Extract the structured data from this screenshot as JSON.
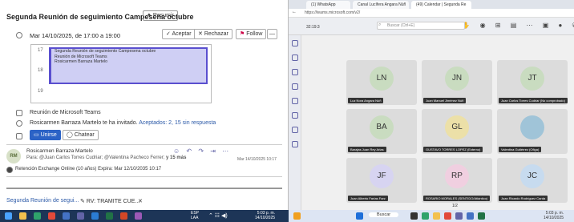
{
  "outlook": {
    "title": "Segunda Reunión de seguimiento Campesena octubre",
    "resume_label": "Resumir",
    "datetime": "Mar 14/10/2025, de 17:00 a 19:00",
    "accept_label": "Aceptar",
    "reject_label": "Rechazar",
    "follow_label": "Follow",
    "hours": [
      "17",
      "18",
      "19"
    ],
    "event_lines": [
      "Segunda Reunión de seguimiento Campesena octubre",
      "Reunión de Microsoft Teams",
      "Rosicarmen Barraza Martelo"
    ],
    "teams_meeting": "Reunión de Microsoft Teams",
    "invited_text": "Rosicarmen Barraza Martelo te ha invitado.",
    "accepted_text": "Aceptados: 2, 15 sin respuesta",
    "join_label": "Unirse",
    "chat_label": "Chatear",
    "avatar_initials": "RM",
    "sender": "Rosicarmen Barraza Martelo",
    "to_line": "Para: @Juan Carlos Torres Cudriar; @Valentina Pacheco Ferrer; ",
    "more": "y 15 más",
    "received": "Mar 14/10/2025 10:17",
    "retention": "Retención Exchange Online (10 años) Expira: Mar 12/10/2035 10:17",
    "bottom_tab1": "Segunda Reunión de segui...",
    "bottom_tab2": "RV: TRAMITE CUE...",
    "clock_time": "5:03 p. m.",
    "clock_date": "14/10/2025",
    "lang": "ESP",
    "lang2": "LAA",
    "colors": {
      "accent": "#2c63c6",
      "event_fill": "#cfcff4",
      "event_border": "#5a4fcf"
    }
  },
  "teams": {
    "tabs": [
      "(1) WhatsApp",
      "Canal Lucífera Angara Núñ",
      "(49) Calendar | Segunda Re"
    ],
    "url": "https://teams.microsoft.com/v2/",
    "search_placeholder": "Buscar (Ctrl+E)",
    "timer": "32:19:3",
    "participants": [
      {
        "initials": "LN",
        "name": "Luz Nora Angara Núñ",
        "color": "#c9dcc0"
      },
      {
        "initials": "JN",
        "name": "Juan Manuel Jiménez Núñ",
        "color": "#c9dcc0"
      },
      {
        "initials": "JT",
        "name": "Juan Carlos Torres Cudriar (No comprobado)",
        "color": "#c9dcc0"
      },
      {
        "initials": "BA",
        "name": "Barajas Juan Rey Arias",
        "color": "#c9dcc0"
      },
      {
        "initials": "GL",
        "name": "GUSTAVO TORRES LOPEZ (Externo)",
        "color": "#ece0a8"
      },
      {
        "initials": "",
        "name": "Valentina Gutiérrez (Ofiga)",
        "color": "#a0c4d8"
      },
      {
        "initials": "JF",
        "name": "Juan Alberto Farías Farz",
        "color": "#d7d4f1"
      },
      {
        "initials": "RP",
        "name": "ROSARIO MORALES (SENTIDO/Atlántico)",
        "color": "#f0cfe0"
      },
      {
        "initials": "JC",
        "name": "Juan Ricardo Rodríguez Carda",
        "color": "#c7dbef"
      }
    ],
    "page": "1/2",
    "taskbar_search": "Buscar",
    "clock_time": "5:03 p. m.",
    "clock_date": "14/10/2025"
  }
}
